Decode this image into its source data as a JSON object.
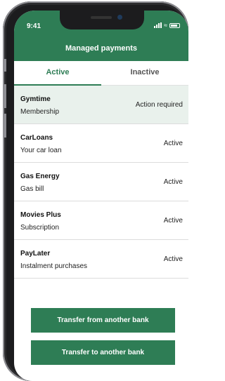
{
  "status_bar": {
    "time": "9:41",
    "icons": [
      "signal-icon",
      "wifi-icon",
      "battery-icon"
    ]
  },
  "header": {
    "title": "Managed payments"
  },
  "tabs": [
    {
      "label": "Active",
      "selected": true
    },
    {
      "label": "Inactive",
      "selected": false
    }
  ],
  "payments": [
    {
      "name": "Gymtime",
      "description": "Membership",
      "status": "Action required"
    },
    {
      "name": "CarLoans",
      "description": "Your car loan",
      "status": "Active"
    },
    {
      "name": "Gas Energy",
      "description": "Gas bill",
      "status": "Active"
    },
    {
      "name": "Movies Plus",
      "description": "Subscription",
      "status": "Active"
    },
    {
      "name": "PayLater",
      "description": "Instalment purchases",
      "status": "Active"
    }
  ],
  "actions": {
    "transfer_from": "Transfer from another bank",
    "transfer_to": "Transfer to another bank"
  },
  "colors": {
    "brand": "#2e7d55",
    "highlight_row": "#e9f1ec"
  }
}
